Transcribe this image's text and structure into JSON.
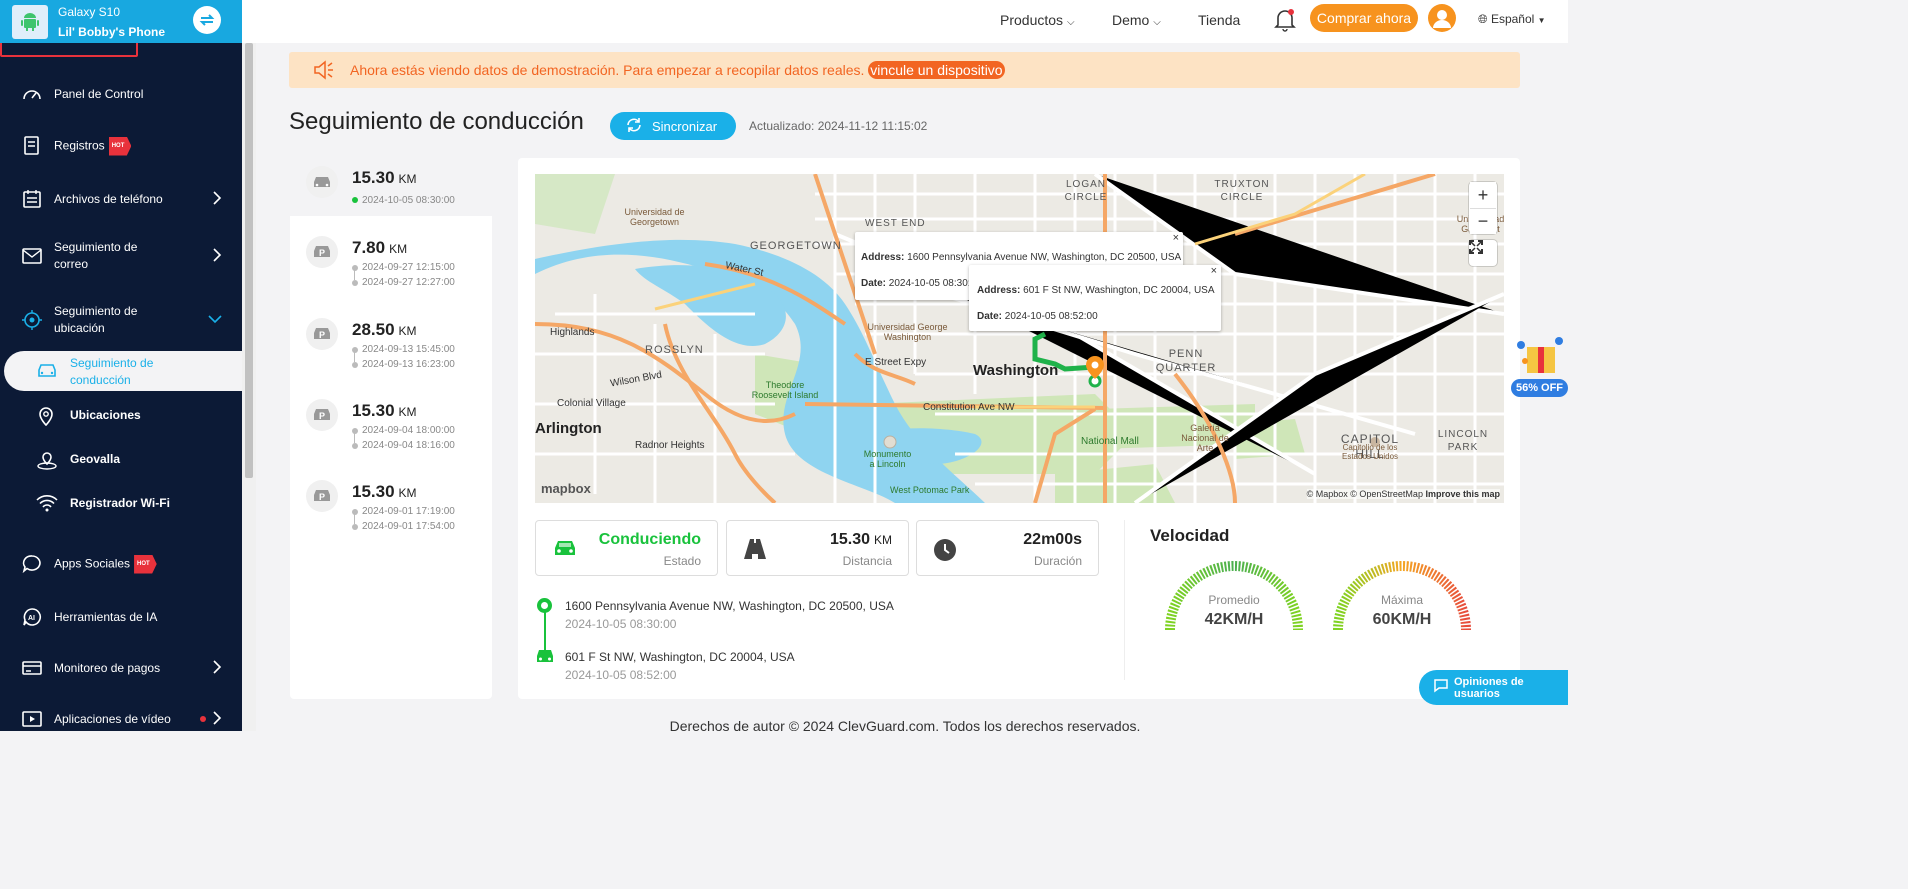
{
  "device": {
    "model": "Galaxy S10",
    "name": "Lil' Bobby's Phone"
  },
  "sidebar": {
    "items": [
      {
        "label": "Panel de Control"
      },
      {
        "label": "Registros",
        "badge": "HOT"
      },
      {
        "label": "Archivos de teléfono"
      },
      {
        "label": "Seguimiento de correo"
      },
      {
        "label": "Seguimiento de ubicación"
      },
      {
        "label": "Apps Sociales",
        "badge": "HOT"
      },
      {
        "label": "Herramientas de IA"
      },
      {
        "label": "Monitoreo de pagos"
      },
      {
        "label": "Aplicaciones de vídeo"
      }
    ],
    "subitems": [
      {
        "label": "Seguimiento de conducción"
      },
      {
        "label": "Ubicaciones"
      },
      {
        "label": "Geovalla"
      },
      {
        "label": "Registrador Wi-Fi"
      }
    ]
  },
  "header": {
    "products": "Productos",
    "demo": "Demo",
    "store": "Tienda",
    "buy": "Comprar ahora",
    "language": "Español"
  },
  "banner": {
    "text": "Ahora estás viendo datos de demostración. Para empezar a recopilar datos reales.",
    "link": "vincule un dispositivo"
  },
  "page": {
    "title": "Seguimiento de conducción",
    "sync_label": "Sincronizar",
    "updated": "Actualizado: 2024-11-12 11:15:02"
  },
  "trips": [
    {
      "distance": "15.30",
      "unit": "KM",
      "type": "car",
      "times": [
        "2024-10-05 08:30:00"
      ]
    },
    {
      "distance": "7.80",
      "unit": "KM",
      "type": "parking",
      "times": [
        "2024-09-27 12:15:00",
        "2024-09-27 12:27:00"
      ]
    },
    {
      "distance": "28.50",
      "unit": "KM",
      "type": "parking",
      "times": [
        "2024-09-13 15:45:00",
        "2024-09-13 16:23:00"
      ]
    },
    {
      "distance": "15.30",
      "unit": "KM",
      "type": "parking",
      "times": [
        "2024-09-04 18:00:00",
        "2024-09-04 18:16:00"
      ]
    },
    {
      "distance": "15.30",
      "unit": "KM",
      "type": "parking",
      "times": [
        "2024-09-01 17:19:00",
        "2024-09-01 17:54:00"
      ]
    }
  ],
  "map": {
    "popups": [
      {
        "address_label": "Address:",
        "address": "1600 Pennsylvania Avenue NW, Washington, DC 20500, USA",
        "date_label": "Date:",
        "date": "2024-10-05 08:30:"
      },
      {
        "address_label": "Address:",
        "address": "601 F St NW, Washington, DC 20004, USA",
        "date_label": "Date:",
        "date": "2024-10-05 08:52:00"
      }
    ],
    "labels": {
      "washington": "Washington",
      "arlington": "Arlington",
      "georgetown": "GEORGETOWN",
      "rosslyn": "ROSSLYN",
      "penn_quarter": "PENN QUARTER",
      "capitol_hill": "CAPITOL HILL",
      "lincoln_park": "LINCOLN PARK",
      "logan_circle": "LOGAN CIRCLE",
      "truxton_circle": "TRUXTON CIRCLE",
      "west_end": "WEST END",
      "national_mall": "National Mall",
      "highlands": "Highlands",
      "colonial_village": "Colonial Village",
      "radnor_heights": "Radnor Heights",
      "theodore": "Theodore Roosevelt Island",
      "constitution": "Constitution Ave NW",
      "water_st": "Water St",
      "wilson_blvd": "Wilson Blvd",
      "e_street": "E Street Expy",
      "gw_university": "Universidad George Washington",
      "georgetown_university": "Universidad de Georgetown",
      "gallaudet": "Universidad Gallaudet",
      "galeria": "Galería Nacional de Arte",
      "capitolio": "Capitolio de los Estados Unidos",
      "monumento": "Monumento a Lincoln",
      "west_potomac": "West Potomac Park",
      "mapbox": "mapbox",
      "attribution": "© Mapbox © OpenStreetMap",
      "improve": "Improve this map"
    }
  },
  "stats": [
    {
      "value": "Conduciendo",
      "label": "Estado"
    },
    {
      "value": "15.30",
      "unit": "KM",
      "label": "Distancia"
    },
    {
      "value": "22m00s",
      "label": "Duración"
    }
  ],
  "route": {
    "start_address": "1600 Pennsylvania Avenue NW, Washington, DC 20500, USA",
    "start_time": "2024-10-05 08:30:00",
    "end_address": "601 F St NW, Washington, DC 20004, USA",
    "end_time": "2024-10-05 08:52:00"
  },
  "speed": {
    "title": "Velocidad",
    "avg_label": "Promedio",
    "avg_value": "42KM/H",
    "max_label": "Máxima",
    "max_value": "60KM/H"
  },
  "footer": "Derechos de autor © 2024 ClevGuard.com. Todos los derechos reservados.",
  "promo": "56% OFF",
  "feedback": "Opiniones de usuarios",
  "colors": {
    "accent": "#1ab0e8",
    "orange": "#f7931e",
    "sidebar": "#0c1a36",
    "green": "#19c23c",
    "alert_red": "#e8323c"
  }
}
